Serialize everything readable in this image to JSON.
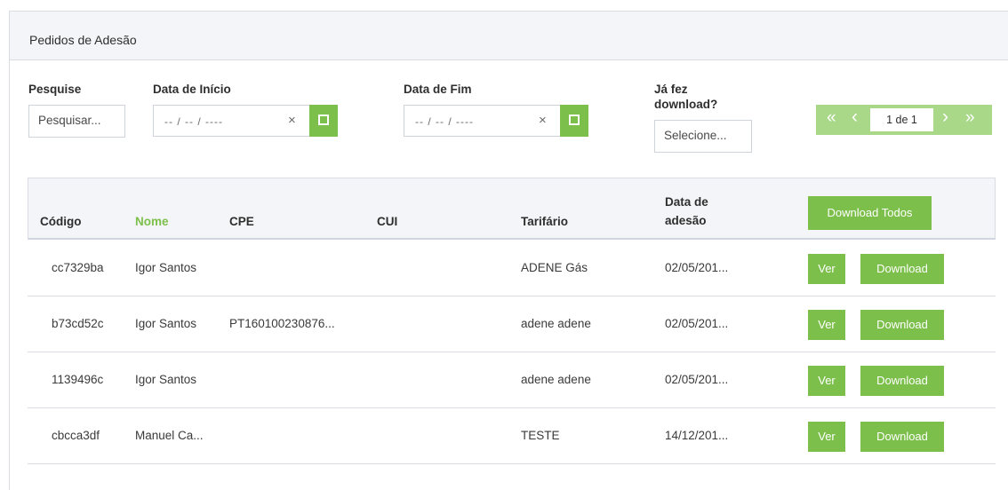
{
  "panel": {
    "title": "Pedidos de Adesão"
  },
  "filters": {
    "search": {
      "label": "Pesquise",
      "placeholder": "Pesquisar..."
    },
    "start_date": {
      "label": "Data de Início",
      "mask": "-- / -- / ----",
      "clear": "×"
    },
    "end_date": {
      "label": "Data de Fim",
      "mask": "-- / -- / ----",
      "clear": "×"
    },
    "downloaded": {
      "label_line1": "Já fez",
      "label_line2": "download?",
      "placeholder": "Selecione..."
    }
  },
  "pager": {
    "first": "«",
    "prev": "‹",
    "info": "1 de 1",
    "next": "›",
    "last": "»"
  },
  "table": {
    "headers": {
      "code": "Código",
      "name": "Nome",
      "cpe": "CPE",
      "cui": "CUI",
      "tariff": "Tarifário",
      "date_line1": "Data de",
      "date_line2": "adesão"
    },
    "sorted_column": "Nome",
    "download_all_label": "Download Todos",
    "view_label": "Ver",
    "download_label": "Download",
    "rows": [
      {
        "code": "cc7329ba",
        "name": "Igor Santos",
        "cpe": "",
        "cui": "",
        "tariff": "ADENE Gás",
        "date": "02/05/201..."
      },
      {
        "code": "b73cd52c",
        "name": "Igor Santos",
        "cpe": "PT160100230876...",
        "cui": "",
        "tariff": "adene adene",
        "date": "02/05/201..."
      },
      {
        "code": "1139496c",
        "name": "Igor Santos",
        "cpe": "",
        "cui": "",
        "tariff": "adene adene",
        "date": "02/05/201..."
      },
      {
        "code": "cbcca3df",
        "name": "Manuel Ca...",
        "cpe": "",
        "cui": "",
        "tariff": "TESTE",
        "date": "14/12/201..."
      }
    ]
  },
  "colors": {
    "accent": "#7cbf4b",
    "pager_bg": "#a9d888",
    "header_bg": "#f3f5f8",
    "border": "#d9dde3"
  }
}
